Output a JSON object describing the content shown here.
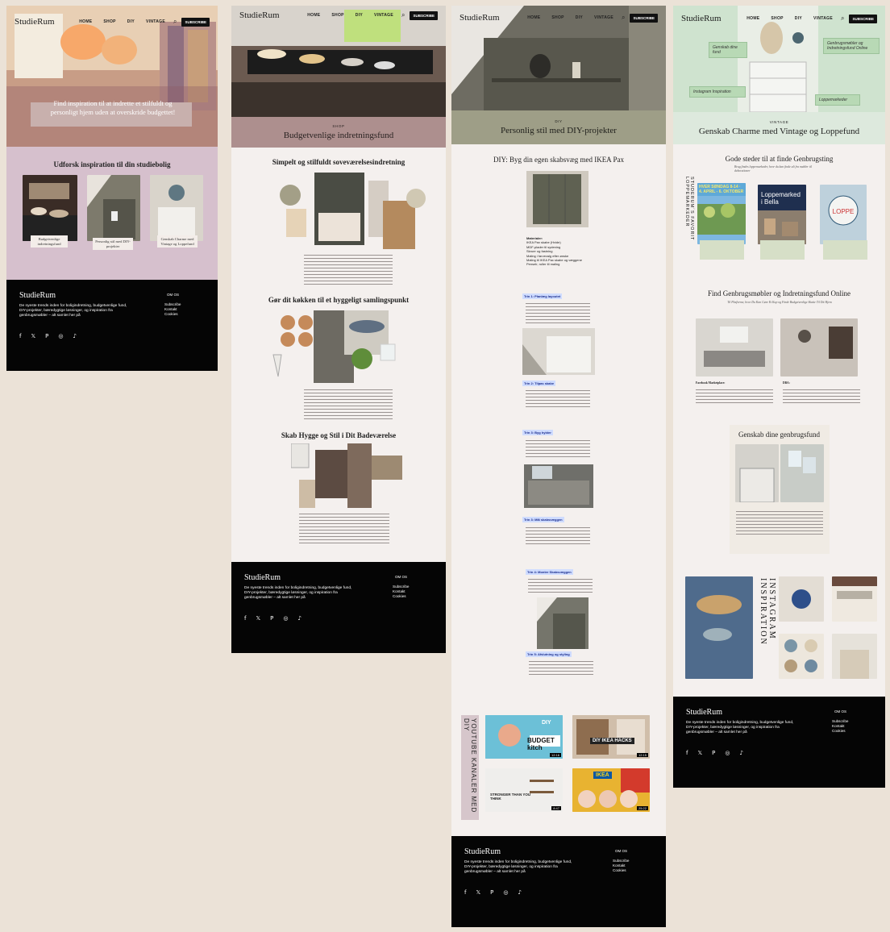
{
  "brand": {
    "logo": "StudieRum",
    "subscribe": "SUBSCRIBE"
  },
  "nav": {
    "home": "HOME",
    "shop": "SHOP",
    "diy": "DIY",
    "vintage": "VINTAGE"
  },
  "colors": {
    "bg": "#ebe2d7",
    "mauve": "#d6c0cd",
    "mauve_band": "#ad8f8e",
    "olive_band": "#9e9e87",
    "sage_band": "#dde9dd",
    "footer": "#050505",
    "step_highlight": "#cfdcff"
  },
  "home": {
    "hero_text": "Find inspiration til at indrette et stilfuldt og personligt hjem uden at overskride budgettet!",
    "explore_title": "Udforsk inspiration til din studiebolig",
    "cards": [
      "Budgetvenlige indretningsfund",
      "Personlig stil med DIY-projekter",
      "Genskab Charme med Vintage og Loppefund"
    ]
  },
  "shop": {
    "kicker": "SHOP",
    "title": "Budgetvenlige indretningsfund",
    "sec1": "Simpelt og stilfuldt soveværelsesindretning",
    "sec2": "Gør dit køkken til et hyggeligt samlingspunkt",
    "sec3": "Skab Hygge og Stil i Dit Badeværelse"
  },
  "diy": {
    "kicker": "DIY",
    "title": "Personlig stil med DIY-projekter",
    "section_title": "DIY: Byg din egen skabsvæg med IKEA Pax",
    "materials_head": "Materialer:",
    "materials": [
      "IKEA Pax skabe (Hvide)",
      "MDF-plader til sydening",
      "Skruer og fastning",
      "Maling i farvevalg efter ønske",
      "Maling til IKEA Pax skabe og væggene",
      "Penselr, ruller til maling"
    ],
    "steps": [
      "Trin 1: Planlæg layoutet",
      "Trin 2: Tilpas skabe",
      "Trin 3: Byg hylder",
      "Trin 3: Mål skabsvæggen",
      "Trin 4: Monter Skabsvæggen",
      "Trin 5: Afslutning og styling"
    ],
    "yt_title": "YOUTUBE KANALER MED DIY",
    "videos": [
      {
        "text": "BUDGET kitch",
        "tag": "DIY",
        "dur": "12:16"
      },
      {
        "text": "DIY IKEA HACKS",
        "tag": "",
        "dur": "12:15"
      },
      {
        "text": "STRONGER THAN YOU THINK",
        "tag": "",
        "dur": "8:47"
      },
      {
        "text": "IKEA",
        "tag": "",
        "dur": "25:22"
      }
    ]
  },
  "vintage": {
    "kicker": "VINTAGE",
    "title": "Genskab Charme med Vintage og Loppefund",
    "tags": [
      "Genskab dine fund",
      "Genbrugsmøbler og Indretningsfund Online",
      "Instagram Inspiration",
      "Loppemarkeder"
    ],
    "places_title": "Gode steder til at finde Genbrugsting",
    "places_sub": "Brug findes loppemarkeder, hvor du kan finde alt fra møbler til dekorationer",
    "vertical_label": "STUDERUM´S FAVORIT LOPPEMARKEDER",
    "market1_banner": "HVER SØNDAG 8-14 · 4. APRIL - 6. OKTOBER",
    "market2_title": "Loppemarked i Bella",
    "online_title": "Find Genbrugsmøbler og Indretningsfund Online",
    "online_sub": "Til Platforme, hvor Du Kan Gøre Et Kup og Finde Budgetvenlige Skatte Til Dit Hjem",
    "online_l": "Facebook Marketplace:",
    "online_r": "DBA:",
    "rework_title": "Genskab dine genbrugsfund",
    "insta_label": "INSTAGRAM INSPIRATION"
  },
  "footer": {
    "logo": "StudieRum",
    "text": "De nyeste trends inden for boligindretning, budgetvenlige fund, DIY-projekter, bæredygtige løsninger, og inspiration fra genbrugsmøbler – alt samlet her på",
    "about": "OM OS",
    "links": [
      "Subscribe",
      "Kontakt",
      "Cookies"
    ],
    "social": [
      "f",
      "𝕏",
      "P",
      "◎",
      "♪"
    ]
  }
}
